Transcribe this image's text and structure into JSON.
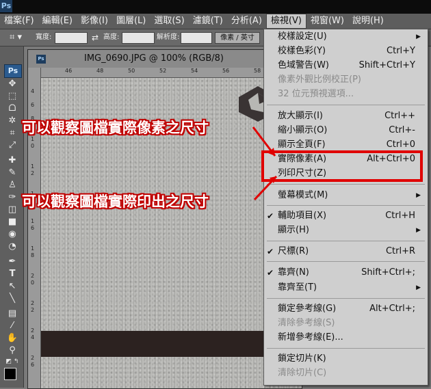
{
  "app": {
    "logo": "Ps",
    "title_color": "#0c0c0c"
  },
  "menubar": {
    "items": [
      "檔案(F)",
      "編輯(E)",
      "影像(I)",
      "圖層(L)",
      "選取(S)",
      "濾鏡(T)",
      "分析(A)",
      "檢視(V)",
      "視窗(W)",
      "說明(H)"
    ],
    "active_index": 7
  },
  "options": {
    "width_label": "寬度:",
    "height_label": "高度:",
    "resolution_label": "解析度:",
    "unit_value": "像素 / 英寸",
    "swap_icon": "swap-icon",
    "crop_icon": "crop-icon"
  },
  "toolbox": {
    "logo": "Ps",
    "tools": [
      "move-icon",
      "marquee-icon",
      "lasso-icon",
      "magic-wand-icon",
      "crop-icon",
      "eyedropper-icon",
      "healing-icon",
      "brush-icon",
      "stamp-icon",
      "history-brush-icon",
      "eraser-icon",
      "gradient-icon",
      "blur-icon",
      "dodge-icon",
      "pen-icon",
      "type-icon",
      "path-select-icon",
      "shape-icon",
      "notes-icon",
      "eyedropper2-icon",
      "hand-icon",
      "zoom-icon"
    ],
    "tool_glyphs": [
      "✥",
      "⬚",
      "ᗝ",
      "✲",
      "⌗",
      "⤢",
      "✚",
      "✎",
      "♙",
      "✑",
      "◫",
      "■",
      "◉",
      "◔",
      "✒",
      "T",
      "↖",
      "╲",
      "▤",
      "⁄",
      "✋",
      "⚲"
    ],
    "foreground_color": "#000000"
  },
  "document": {
    "title": "IMG_0690.JPG @ 100% (RGB/8)",
    "ruler_labels": [
      "46",
      "48",
      "50",
      "52",
      "54",
      "56",
      "58",
      "60"
    ],
    "left_ruler_labels": [
      "4",
      "6",
      "8",
      "1",
      "0",
      "1",
      "2",
      "1",
      "4",
      "1",
      "6",
      "1",
      "8",
      "2",
      "0",
      "2",
      "2",
      "2",
      "4",
      "2",
      "6",
      "2",
      "8"
    ]
  },
  "view_menu": {
    "items": [
      {
        "label": "校樣設定(U)",
        "shortcut": "",
        "submenu": true,
        "disabled": false,
        "checked": false
      },
      {
        "label": "校樣色彩(Y)",
        "shortcut": "Ctrl+Y",
        "submenu": false,
        "disabled": false,
        "checked": false
      },
      {
        "label": "色域警告(W)",
        "shortcut": "Shift+Ctrl+Y",
        "submenu": false,
        "disabled": false,
        "checked": false
      },
      {
        "label": "像素外觀比例校正(P)",
        "shortcut": "",
        "submenu": false,
        "disabled": true,
        "checked": false
      },
      {
        "label": "32 位元預視選項...",
        "shortcut": "",
        "submenu": false,
        "disabled": true,
        "checked": false
      },
      {
        "label": "放大顯示(I)",
        "shortcut": "Ctrl++",
        "submenu": false,
        "disabled": false,
        "checked": false
      },
      {
        "label": "縮小顯示(O)",
        "shortcut": "Ctrl+-",
        "submenu": false,
        "disabled": false,
        "checked": false
      },
      {
        "label": "顯示全頁(F)",
        "shortcut": "Ctrl+0",
        "submenu": false,
        "disabled": false,
        "checked": false
      },
      {
        "label": "實際像素(A)",
        "shortcut": "Alt+Ctrl+0",
        "submenu": false,
        "disabled": false,
        "checked": false
      },
      {
        "label": "列印尺寸(Z)",
        "shortcut": "",
        "submenu": false,
        "disabled": false,
        "checked": false
      },
      {
        "label": "螢幕模式(M)",
        "shortcut": "",
        "submenu": true,
        "disabled": false,
        "checked": false
      },
      {
        "label": "輔助項目(X)",
        "shortcut": "Ctrl+H",
        "submenu": false,
        "disabled": false,
        "checked": true
      },
      {
        "label": "顯示(H)",
        "shortcut": "",
        "submenu": true,
        "disabled": false,
        "checked": false
      },
      {
        "label": "尺標(R)",
        "shortcut": "Ctrl+R",
        "submenu": false,
        "disabled": false,
        "checked": true
      },
      {
        "label": "靠齊(N)",
        "shortcut": "Shift+Ctrl+;",
        "submenu": false,
        "disabled": false,
        "checked": true
      },
      {
        "label": "靠齊至(T)",
        "shortcut": "",
        "submenu": true,
        "disabled": false,
        "checked": false
      },
      {
        "label": "鎖定參考線(G)",
        "shortcut": "Alt+Ctrl+;",
        "submenu": false,
        "disabled": false,
        "checked": false
      },
      {
        "label": "清除參考線(S)",
        "shortcut": "",
        "submenu": false,
        "disabled": true,
        "checked": false
      },
      {
        "label": "新增參考線(E)...",
        "shortcut": "",
        "submenu": false,
        "disabled": false,
        "checked": false
      },
      {
        "label": "鎖定切片(K)",
        "shortcut": "",
        "submenu": false,
        "disabled": false,
        "checked": false
      },
      {
        "label": "清除切片(C)",
        "shortcut": "",
        "submenu": false,
        "disabled": true,
        "checked": false
      }
    ],
    "check_glyph": "✔",
    "submenu_glyph": "▶"
  },
  "annotations": {
    "actual_pixels_note": "可以觀察圖檔實際像素之尺寸",
    "print_size_note": "可以觀察圖檔實際印出之尺寸",
    "color": "#e00000"
  }
}
